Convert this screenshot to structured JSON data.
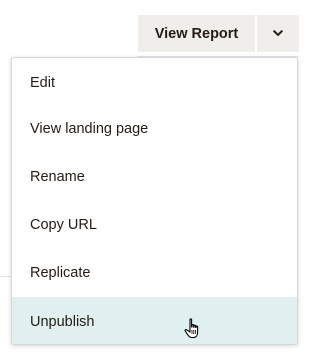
{
  "header": {
    "view_report_label": "View Report",
    "dropdown_toggle_icon": "chevron-down-icon"
  },
  "menu": {
    "items": [
      {
        "label": "Edit"
      },
      {
        "label": "View landing page"
      },
      {
        "label": "Rename"
      },
      {
        "label": "Copy URL"
      },
      {
        "label": "Replicate"
      },
      {
        "label": "Unpublish",
        "state": "hovered"
      }
    ]
  },
  "cursor": {
    "icon": "hand-pointer-icon"
  },
  "colors": {
    "button_bg": "#efeeea",
    "text": "#241c15",
    "hover_bg": "#e0eff0",
    "menu_border": "#d9d7d2"
  }
}
